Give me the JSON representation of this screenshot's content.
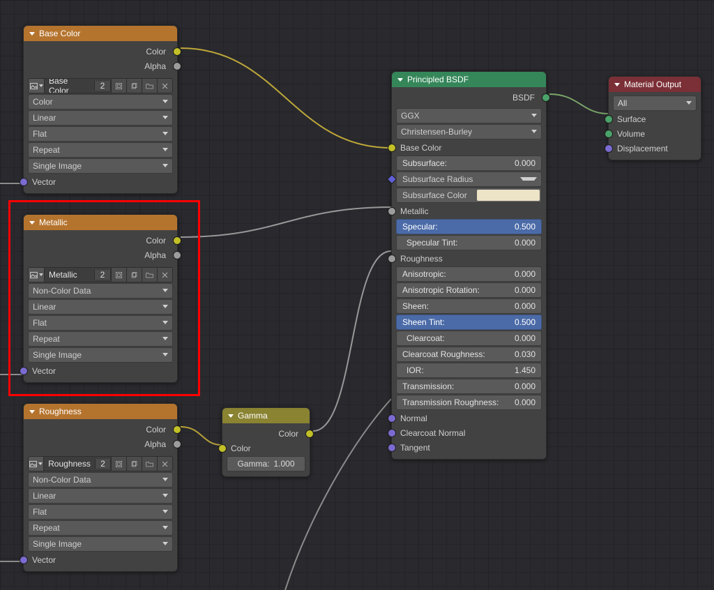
{
  "nodes": {
    "base_color": {
      "title": "Base Color",
      "outputs": {
        "color": "Color",
        "alpha": "Alpha"
      },
      "image_slot": {
        "name": "Base Color",
        "users": "2"
      },
      "combos": [
        "Color",
        "Linear",
        "Flat",
        "Repeat",
        "Single Image"
      ],
      "input": "Vector"
    },
    "metallic": {
      "title": "Metallic",
      "outputs": {
        "color": "Color",
        "alpha": "Alpha"
      },
      "image_slot": {
        "name": "Metallic",
        "users": "2"
      },
      "combos": [
        "Non-Color Data",
        "Linear",
        "Flat",
        "Repeat",
        "Single Image"
      ],
      "input": "Vector"
    },
    "roughness": {
      "title": "Roughness",
      "outputs": {
        "color": "Color",
        "alpha": "Alpha"
      },
      "image_slot": {
        "name": "Roughness",
        "users": "2"
      },
      "combos": [
        "Non-Color Data",
        "Linear",
        "Flat",
        "Repeat",
        "Single Image"
      ],
      "input": "Vector"
    },
    "gamma": {
      "title": "Gamma",
      "outputs": {
        "color": "Color"
      },
      "inputs": {
        "color": "Color"
      },
      "gamma_label": "Gamma:",
      "gamma_value": "1.000"
    },
    "principled": {
      "title": "Principled BSDF",
      "outputs": {
        "bsdf": "BSDF"
      },
      "distribution": "GGX",
      "sss_method": "Christensen-Burley",
      "rows": {
        "base_color": "Base Color",
        "subsurface": {
          "label": "Subsurface:",
          "value": "0.000"
        },
        "subsurface_radius": "Subsurface Radius",
        "subsurface_color": "Subsurface Color",
        "metallic": "Metallic",
        "specular": {
          "label": "Specular:",
          "value": "0.500"
        },
        "specular_tint": {
          "label": "Specular Tint:",
          "value": "0.000"
        },
        "roughness": "Roughness",
        "anisotropic": {
          "label": "Anisotropic:",
          "value": "0.000"
        },
        "aniso_rot": {
          "label": "Anisotropic Rotation:",
          "value": "0.000"
        },
        "sheen": {
          "label": "Sheen:",
          "value": "0.000"
        },
        "sheen_tint": {
          "label": "Sheen Tint:",
          "value": "0.500"
        },
        "clearcoat": {
          "label": "Clearcoat:",
          "value": "0.000"
        },
        "clearcoat_rough": {
          "label": "Clearcoat Roughness:",
          "value": "0.030"
        },
        "ior": {
          "label": "IOR:",
          "value": "1.450"
        },
        "transmission": {
          "label": "Transmission:",
          "value": "0.000"
        },
        "transmission_rough": {
          "label": "Transmission Roughness:",
          "value": "0.000"
        },
        "normal": "Normal",
        "clearcoat_normal": "Clearcoat Normal",
        "tangent": "Tangent"
      }
    },
    "material_output": {
      "title": "Material Output",
      "target": "All",
      "inputs": {
        "surface": "Surface",
        "volume": "Volume",
        "displacement": "Displacement"
      }
    }
  },
  "icons": {
    "image_file": "image-icon",
    "fake_user": "F-icon",
    "new": "plus-icon",
    "open": "folder-icon",
    "unlink": "x-icon"
  }
}
